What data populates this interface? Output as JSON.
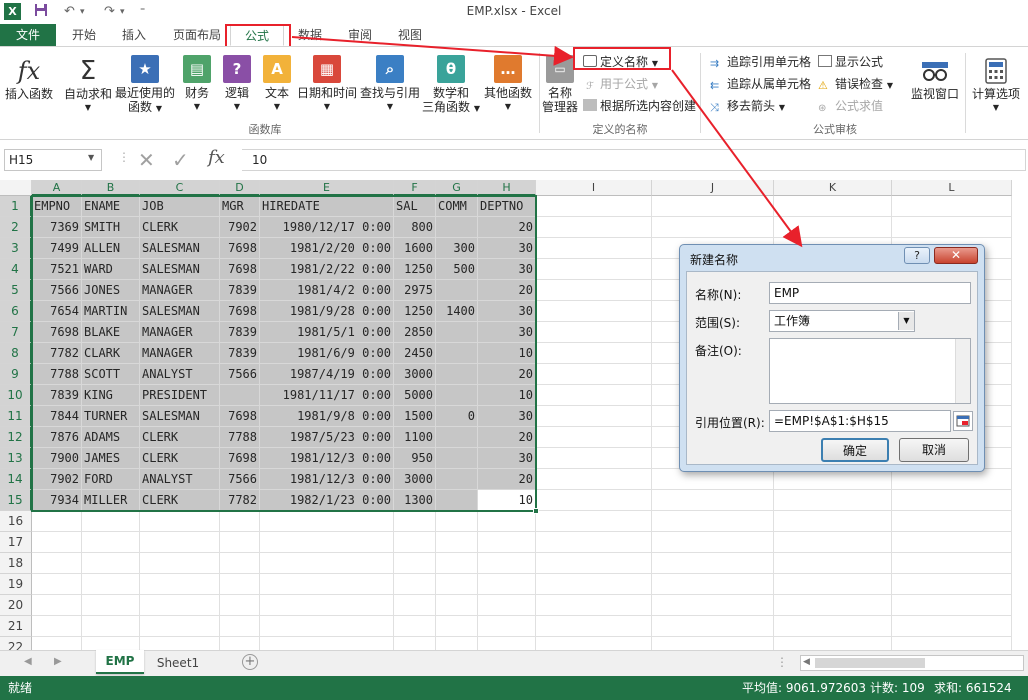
{
  "app": {
    "doc_title": "EMP.xlsx - Excel"
  },
  "tabs": {
    "file": "文件",
    "items": [
      "开始",
      "插入",
      "页面布局",
      "公式",
      "数据",
      "审阅",
      "视图"
    ],
    "active": "公式"
  },
  "ribbon": {
    "function_library": {
      "group": "函数库",
      "insert_function": "插入函数",
      "autosum": "自动求和",
      "recent": [
        "最近使用的",
        "函数"
      ],
      "financial": "财务",
      "logical": "逻辑",
      "text": "文本",
      "datetime": "日期和时间",
      "lookup": "查找与引用",
      "math": [
        "数学和",
        "三角函数"
      ],
      "more": "其他函数"
    },
    "defined_names": {
      "group": "定义的名称",
      "name_manager": [
        "名称",
        "管理器"
      ],
      "define_name": "定义名称",
      "use_in_formula": "用于公式",
      "create_from_selection": "根据所选内容创建"
    },
    "formula_auditing": {
      "group": "公式审核",
      "trace_precedents": "追踪引用单元格",
      "trace_dependents": "追踪从属单元格",
      "remove_arrows": "移去箭头",
      "show_formulas": "显示公式",
      "error_checking": "错误检查",
      "evaluate_formula": "公式求值",
      "watch_window": "监视窗口"
    },
    "calculation": {
      "options": "计算选项"
    }
  },
  "formula_bar": {
    "name_box": "H15",
    "value": "10",
    "fx": "fx"
  },
  "grid": {
    "columns": [
      "A",
      "B",
      "C",
      "D",
      "E",
      "F",
      "G",
      "H",
      "I",
      "J",
      "K",
      "L"
    ],
    "rows": [
      "1",
      "2",
      "3",
      "4",
      "5",
      "6",
      "7",
      "8",
      "9",
      "10",
      "11",
      "12",
      "13",
      "14",
      "15",
      "16",
      "17",
      "18",
      "19",
      "20",
      "21",
      "22"
    ],
    "header": [
      "EMPNO",
      "ENAME",
      "JOB",
      "MGR",
      "HIREDATE",
      "SAL",
      "COMM",
      "DEPTNO"
    ],
    "data": [
      [
        "7369",
        "SMITH",
        "CLERK",
        "7902",
        "1980/12/17 0:00",
        "800",
        "",
        "20"
      ],
      [
        "7499",
        "ALLEN",
        "SALESMAN",
        "7698",
        "1981/2/20 0:00",
        "1600",
        "300",
        "30"
      ],
      [
        "7521",
        "WARD",
        "SALESMAN",
        "7698",
        "1981/2/22 0:00",
        "1250",
        "500",
        "30"
      ],
      [
        "7566",
        "JONES",
        "MANAGER",
        "7839",
        "1981/4/2 0:00",
        "2975",
        "",
        "20"
      ],
      [
        "7654",
        "MARTIN",
        "SALESMAN",
        "7698",
        "1981/9/28 0:00",
        "1250",
        "1400",
        "30"
      ],
      [
        "7698",
        "BLAKE",
        "MANAGER",
        "7839",
        "1981/5/1 0:00",
        "2850",
        "",
        "30"
      ],
      [
        "7782",
        "CLARK",
        "MANAGER",
        "7839",
        "1981/6/9 0:00",
        "2450",
        "",
        "10"
      ],
      [
        "7788",
        "SCOTT",
        "ANALYST",
        "7566",
        "1987/4/19 0:00",
        "3000",
        "",
        "20"
      ],
      [
        "7839",
        "KING",
        "PRESIDENT",
        "",
        "1981/11/17 0:00",
        "5000",
        "",
        "10"
      ],
      [
        "7844",
        "TURNER",
        "SALESMAN",
        "7698",
        "1981/9/8 0:00",
        "1500",
        "0",
        "30"
      ],
      [
        "7876",
        "ADAMS",
        "CLERK",
        "7788",
        "1987/5/23 0:00",
        "1100",
        "",
        "20"
      ],
      [
        "7900",
        "JAMES",
        "CLERK",
        "7698",
        "1981/12/3 0:00",
        "950",
        "",
        "30"
      ],
      [
        "7902",
        "FORD",
        "ANALYST",
        "7566",
        "1981/12/3 0:00",
        "3000",
        "",
        "20"
      ],
      [
        "7934",
        "MILLER",
        "CLERK",
        "7782",
        "1982/1/23 0:00",
        "1300",
        "",
        "10"
      ]
    ]
  },
  "dialog": {
    "title": "新建名称",
    "help": "?",
    "name_label": "名称(N):",
    "name_value": "EMP",
    "scope_label": "范围(S):",
    "scope_value": "工作簿",
    "comment_label": "备注(O):",
    "ref_label": "引用位置(R):",
    "ref_value": "=EMP!$A$1:$H$15",
    "ok": "确定",
    "cancel": "取消"
  },
  "sheets": {
    "tabs": [
      "EMP",
      "Sheet1"
    ],
    "active": "EMP"
  },
  "status": {
    "ready": "就绪",
    "average": "平均值: 9061.972603",
    "count": "计数: 109",
    "sum": "求和: 661524"
  },
  "colors": {
    "excel_green": "#217346",
    "annotation_red": "#e8212b"
  }
}
